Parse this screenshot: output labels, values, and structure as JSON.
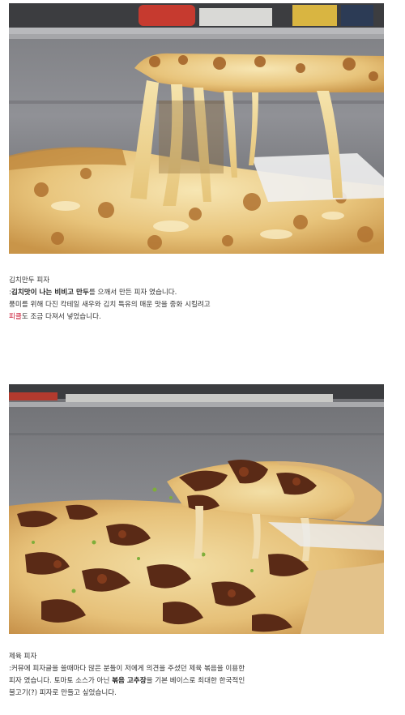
{
  "posts": [
    {
      "title": "김치만두 피자",
      "line1": {
        "prefix": ":",
        "bold1": "김치맛이 나는 비비고 만두",
        "mid": "를 으깨서 만든 피자 였습니다."
      },
      "line2": "풍미를 위해 다진 칵테일 새우와 김치 특유의 매운 맛을 중화 시킬려고",
      "line3": {
        "red": "피클",
        "rest": "도 조금 다져서 넣었습니다."
      }
    },
    {
      "title": "제육 피자",
      "line1": ":커뮤에 피자글을 쓸때마다 많은 분들이 저에게 의견을 주셨던 제육 볶음을 이용한",
      "line2": {
        "pre": "피자 였습니다. 토마토 소스가 아닌 ",
        "bold": "볶음 고추장",
        "post": "을 기본 베이스로 최대한 한국적인"
      },
      "line3": "불고기(?) 피자로 만들고 싶었습니다."
    }
  ]
}
